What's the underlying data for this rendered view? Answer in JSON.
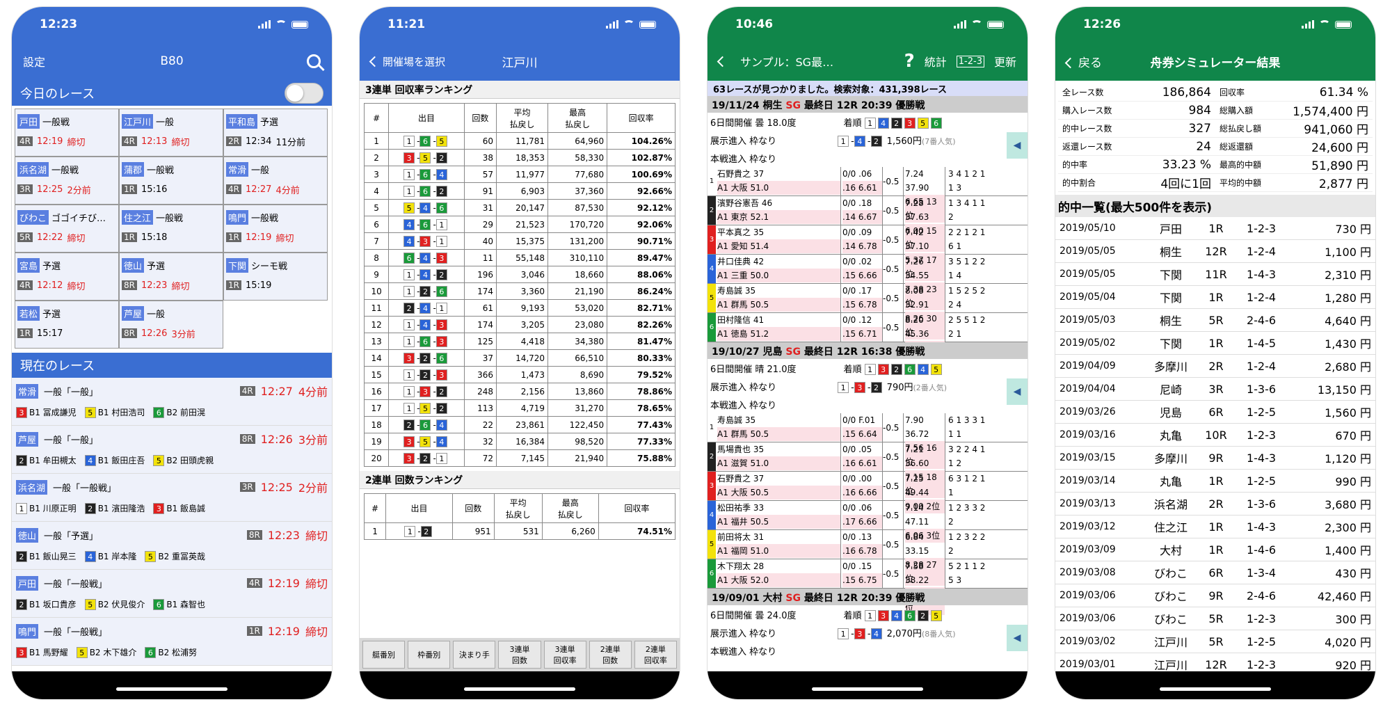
{
  "colors": {
    "blue": "#3a6ed2",
    "green": "#10864a",
    "red": "#e02020"
  },
  "p1": {
    "time": "12:23",
    "nav_left": "設定",
    "nav_title": "B80",
    "today_title": "今日のレース",
    "today": [
      {
        "venue": "戸田",
        "grade": "一般戦",
        "race": "4R",
        "time": "12:19",
        "status": "締切",
        "red": true
      },
      {
        "venue": "江戸川",
        "grade": "一般",
        "race": "4R",
        "time": "12:13",
        "status": "締切",
        "red": true
      },
      {
        "venue": "平和島",
        "grade": "予選",
        "race": "2R",
        "time": "12:34",
        "status": "11分前",
        "red": false
      },
      {
        "venue": "浜名湖",
        "grade": "一般戦",
        "race": "3R",
        "time": "12:25",
        "status": "2分前",
        "red": true
      },
      {
        "venue": "蒲郡",
        "grade": "一般戦",
        "race": "1R",
        "time": "15:16",
        "status": "",
        "red": false
      },
      {
        "venue": "常滑",
        "grade": "一般",
        "race": "4R",
        "time": "12:27",
        "status": "4分前",
        "red": true
      },
      {
        "venue": "びわこ",
        "grade": "ゴゴイチび…",
        "race": "5R",
        "time": "12:22",
        "status": "締切",
        "red": true
      },
      {
        "venue": "住之江",
        "grade": "一般戦",
        "race": "1R",
        "time": "15:18",
        "status": "",
        "red": false
      },
      {
        "venue": "鳴門",
        "grade": "一般戦",
        "race": "1R",
        "time": "12:19",
        "status": "締切",
        "red": true
      },
      {
        "venue": "宮島",
        "grade": "予選",
        "race": "4R",
        "time": "12:12",
        "status": "締切",
        "red": true
      },
      {
        "venue": "徳山",
        "grade": "予選",
        "race": "8R",
        "time": "12:23",
        "status": "締切",
        "red": true
      },
      {
        "venue": "下関",
        "grade": "シーモ戦",
        "race": "1R",
        "time": "15:19",
        "status": "",
        "red": false
      },
      {
        "venue": "若松",
        "grade": "予選",
        "race": "1R",
        "time": "15:17",
        "status": "",
        "red": false
      },
      {
        "venue": "芦屋",
        "grade": "一般",
        "race": "8R",
        "time": "12:26",
        "status": "3分前",
        "red": true
      }
    ],
    "current_title": "現在のレース",
    "current": [
      {
        "venue": "常滑",
        "name": "一般「一般」",
        "race": "4R",
        "time": "12:27",
        "status": "4分前",
        "boats": [
          [
            "3",
            "B1 冨成謙児"
          ],
          [
            "5",
            "B1 村田浩司"
          ],
          [
            "6",
            "B2 前田滉"
          ]
        ]
      },
      {
        "venue": "芦屋",
        "name": "一般「一般」",
        "race": "8R",
        "time": "12:26",
        "status": "3分前",
        "boats": [
          [
            "2",
            "B1 牟田槻太"
          ],
          [
            "4",
            "B1 飯田庄吾"
          ],
          [
            "5",
            "B2 田頭虎親"
          ]
        ]
      },
      {
        "venue": "浜名湖",
        "name": "一般「一般戦」",
        "race": "3R",
        "time": "12:25",
        "status": "2分前",
        "boats": [
          [
            "1",
            "B1 川原正明"
          ],
          [
            "2",
            "B1 濱田隆浩"
          ],
          [
            "3",
            "B1 飯島誠"
          ]
        ]
      },
      {
        "venue": "徳山",
        "name": "一般「予選」",
        "race": "8R",
        "time": "12:23",
        "status": "締切",
        "boats": [
          [
            "2",
            "B1 飯山晃三"
          ],
          [
            "4",
            "B1 岸本隆"
          ],
          [
            "5",
            "B2 重冨英哉"
          ]
        ]
      },
      {
        "venue": "戸田",
        "name": "一般「一般戦」",
        "race": "4R",
        "time": "12:19",
        "status": "締切",
        "boats": [
          [
            "2",
            "B1 坂口貴彦"
          ],
          [
            "5",
            "B2 伏見俊介"
          ],
          [
            "6",
            "B1 森智也"
          ]
        ]
      },
      {
        "venue": "鳴門",
        "name": "一般「一般戦」",
        "race": "1R",
        "time": "12:19",
        "status": "締切",
        "boats": [
          [
            "3",
            "B1 馬野耀"
          ],
          [
            "5",
            "B2 木下雄介"
          ],
          [
            "6",
            "B2 松浦努"
          ]
        ]
      }
    ]
  },
  "p2": {
    "time": "11:21",
    "nav_back": "開催場を選択",
    "nav_title": "江戸川",
    "t1_title": "3連単 回収率ランキング",
    "t1_headers": [
      "#",
      "出目",
      "回数",
      "平均\n払戻し",
      "最高\n払戻し",
      "回収率"
    ],
    "t1_rows": [
      [
        "1",
        "1-6-5",
        "60",
        "11,781",
        "64,960",
        "104.26%"
      ],
      [
        "2",
        "3-5-2",
        "38",
        "18,353",
        "58,330",
        "102.87%"
      ],
      [
        "3",
        "1-6-4",
        "57",
        "11,977",
        "77,680",
        "100.69%"
      ],
      [
        "4",
        "1-6-2",
        "91",
        "6,903",
        "37,360",
        "92.66%"
      ],
      [
        "5",
        "5-4-6",
        "31",
        "20,147",
        "87,530",
        "92.12%"
      ],
      [
        "6",
        "4-6-1",
        "29",
        "21,523",
        "170,720",
        "92.06%"
      ],
      [
        "7",
        "4-3-1",
        "40",
        "15,375",
        "131,200",
        "90.71%"
      ],
      [
        "8",
        "6-4-3",
        "11",
        "55,148",
        "310,110",
        "89.47%"
      ],
      [
        "9",
        "1-4-2",
        "196",
        "3,046",
        "18,660",
        "88.06%"
      ],
      [
        "10",
        "1-2-6",
        "174",
        "3,360",
        "21,190",
        "86.24%"
      ],
      [
        "11",
        "2-4-1",
        "61",
        "9,193",
        "53,020",
        "82.71%"
      ],
      [
        "12",
        "1-4-3",
        "174",
        "3,205",
        "23,080",
        "82.26%"
      ],
      [
        "13",
        "1-6-3",
        "125",
        "4,418",
        "34,380",
        "81.47%"
      ],
      [
        "14",
        "3-2-6",
        "37",
        "14,720",
        "66,510",
        "80.33%"
      ],
      [
        "15",
        "1-2-3",
        "366",
        "1,473",
        "8,690",
        "79.52%"
      ],
      [
        "16",
        "1-3-2",
        "248",
        "2,156",
        "13,860",
        "78.86%"
      ],
      [
        "17",
        "1-5-2",
        "113",
        "4,719",
        "31,270",
        "78.65%"
      ],
      [
        "18",
        "2-6-4",
        "22",
        "23,861",
        "122,450",
        "77.43%"
      ],
      [
        "19",
        "3-5-4",
        "32",
        "16,384",
        "98,520",
        "77.33%"
      ],
      [
        "20",
        "3-2-1",
        "72",
        "7,145",
        "21,940",
        "75.88%"
      ]
    ],
    "t2_title": "2連単 回数ランキング",
    "t2_rows": [
      [
        "1",
        "1-2",
        "951",
        "531",
        "6,260",
        "74.51%"
      ]
    ],
    "tabs": [
      "艇番別",
      "枠番別",
      "決まり手",
      "3連単\n回数",
      "3連単\n回収率",
      "2連単\n回数",
      "2連単\n回収率"
    ]
  },
  "p3": {
    "time": "10:46",
    "nav_title": "サンプル：SG最…",
    "nav_q": "?",
    "nav_stats": "統計",
    "nav_123": "1-2-3",
    "nav_update": "更新",
    "info": "63レースが見つかりました。検索対象：431,398レース",
    "races": [
      {
        "head_pre": "19/11/24 桐生 ",
        "sg": "SG",
        "head_post": " 最終日 12R 20:39 優勝戦",
        "cond": "6日間開催 曇 18.0度",
        "order_label": "着順",
        "order": [
          "1",
          "4",
          "2",
          "3",
          "5",
          "6"
        ],
        "entry": "展示進入 枠なり",
        "result": [
          "1",
          "4",
          "2"
        ],
        "payout": "1,560円",
        "pop": "(7番人気)",
        "main": "本戦進入 枠なり",
        "racers": [
          {
            "lane": "1",
            "n1": "石野貴之 37",
            "n2": "A1 大阪 51.0",
            "s1": "0/0 .06",
            "s2": ".16 6.61",
            "ex": "-0.5",
            "t1": "7.24 37.90",
            "t2": "6.65 13位",
            "r1": "3 4 1 2 1",
            "r2": "1 3"
          },
          {
            "lane": "2",
            "n1": "濱野谷憲吾 46",
            "n2": "A1 東京 52.1",
            "s1": "0/0 .18",
            "s2": ".14 6.67",
            "ex": "-0.5",
            "t1": "7.28 37.63",
            "t2": "6.00 15位",
            "r1": "1 3 4 1 1",
            "r2": "2"
          },
          {
            "lane": "3",
            "n1": "平本真之 35",
            "n2": "A1 愛知 51.4",
            "s1": "0/0 .09",
            "s2": ".14 6.78",
            "ex": "-0.5",
            "t1": "7.42 37.10",
            "t2": "5.37 17位",
            "r1": "2 2 1 2 1",
            "r2": "6 1"
          },
          {
            "lane": "4",
            "n1": "井口佳典 42",
            "n2": "A1 三重 50.0",
            "s1": "0/0 .02",
            "s2": ".15 6.66",
            "ex": "-0.5",
            "t1": "7.26 34.55",
            "t2": "7.38 23位",
            "r1": "3 5 1 2 2",
            "r2": "1 4"
          },
          {
            "lane": "5",
            "n1": "寿島誠 35",
            "n2": "A1 群馬 50.5",
            "s1": "0/0 .17",
            "s2": ".15 6.78",
            "ex": "-0.5",
            "t1": "8.08 32.91",
            "t2": "8.26 30位",
            "r1": "1 5 2 5 2",
            "r2": "2 4"
          },
          {
            "lane": "6",
            "n1": "田村隆信 41",
            "n2": "A1 徳島 51.2",
            "s1": "0/0 .12",
            "s2": ".15 6.71",
            "ex": "-0.5",
            "t1": "8.20 45.36",
            "t2": "6.33 5位",
            "r1": "2 5 5 1 2",
            "r2": "2 1"
          }
        ]
      },
      {
        "head_pre": "19/10/27 児島 ",
        "sg": "SG",
        "head_post": " 最終日 12R 16:38 優勝戦",
        "cond": "6日間開催 晴 21.0度",
        "order_label": "着順",
        "order": [
          "1",
          "3",
          "2",
          "6",
          "4",
          "5"
        ],
        "entry": "展示進入 枠なり",
        "result": [
          "1",
          "3",
          "2"
        ],
        "payout": "790円",
        "pop": "(2番人気)",
        "main": "本戦進入 枠なり",
        "racers": [
          {
            "lane": "1",
            "n1": "寿島誠 35",
            "n2": "A1 群馬 50.5",
            "s1": "0/0 F.01",
            "s2": ".15 6.64",
            "ex": "-0.5",
            "t1": "7.90 36.72",
            "t2": "7.56 16位",
            "r1": "6 1 3 3 1",
            "r2": "1 1"
          },
          {
            "lane": "2",
            "n1": "馬場貴也 35",
            "n2": "A1 滋賀 51.0",
            "s1": "0/0 .05",
            "s2": ".16 6.61",
            "ex": "-0.5",
            "t1": "7.21 36.60",
            "t2": "7.15 18位",
            "r1": "3 2 2 4 1",
            "r2": "1 2"
          },
          {
            "lane": "3",
            "n1": "石野貴之 37",
            "n2": "A1 大阪 50.5",
            "s1": "0/0 .00",
            "s2": ".16 6.66",
            "ex": "-0.5",
            "t1": "7.25 49.44",
            "t2": "9.00 2位",
            "r1": "6 3 1 2 1",
            "r2": "1"
          },
          {
            "lane": "4",
            "n1": "松田祐季 33",
            "n2": "A1 福井 50.5",
            "s1": "0/0 .06",
            "s2": ".17 6.66",
            "ex": "-0.5",
            "t1": "7.14 47.11",
            "t2": "6.06 3位",
            "r1": "1 2 3 3 2",
            "r2": "2"
          },
          {
            "lane": "5",
            "n1": "前田将太 31",
            "n2": "A1 福岡 51.0",
            "s1": "0/0 .13",
            "s2": ".16 6.78",
            "ex": "-0.5",
            "t1": "6.84 33.15",
            "t2": "8.28 27位",
            "r1": "1 2 3 2 2",
            "r2": "2"
          },
          {
            "lane": "6",
            "n1": "木下翔太 28",
            "n2": "A1 大阪 52.0",
            "s1": "0/0 .15",
            "s2": ".15 6.75",
            "ex": "-0.5",
            "t1": "7.58 38.22",
            "t2": "6.11 14位",
            "r1": "5 2 1 1 2",
            "r2": "5 3"
          }
        ]
      },
      {
        "head_pre": "19/09/01 大村 ",
        "sg": "SG",
        "head_post": " 最終日 12R 20:39 優勝戦",
        "cond": "6日間開催 曇 24.0度",
        "order_label": "着順",
        "order": [
          "1",
          "3",
          "4",
          "6",
          "2",
          "5"
        ],
        "entry": "展示進入 枠なり",
        "result": [
          "1",
          "3",
          "4"
        ],
        "payout": "2,070円",
        "pop": "(8番人気)",
        "main": "本戦進入 枠なり",
        "racers": []
      }
    ]
  },
  "p4": {
    "time": "12:26",
    "nav_back": "戻る",
    "nav_title": "舟券シミュレーター結果",
    "stats": [
      [
        "全レース数",
        "186,864"
      ],
      [
        "回収率",
        "61.34 %"
      ],
      [
        "購入レース数",
        "984"
      ],
      [
        "総購入額",
        "1,574,400 円"
      ],
      [
        "的中レース数",
        "327"
      ],
      [
        "総払戻し額",
        "941,060 円"
      ],
      [
        "返還レース数",
        "24"
      ],
      [
        "総返還額",
        "24,600 円"
      ],
      [
        "的中率",
        "33.23 %"
      ],
      [
        "最高的中額",
        "51,890 円"
      ],
      [
        "的中割合",
        "4回に1回"
      ],
      [
        "平均的中額",
        "2,877 円"
      ]
    ],
    "hits_title": "的中一覧(最大500件を表示)",
    "hits": [
      [
        "2019/05/10",
        "戸田",
        "1R",
        "1-2-3",
        "730 円"
      ],
      [
        "2019/05/05",
        "桐生",
        "12R",
        "1-2-4",
        "1,100 円"
      ],
      [
        "2019/05/05",
        "下関",
        "11R",
        "1-4-3",
        "2,310 円"
      ],
      [
        "2019/05/04",
        "下関",
        "1R",
        "1-2-4",
        "1,280 円"
      ],
      [
        "2019/05/03",
        "桐生",
        "5R",
        "2-4-6",
        "4,640 円"
      ],
      [
        "2019/05/02",
        "下関",
        "1R",
        "1-4-5",
        "1,430 円"
      ],
      [
        "2019/04/09",
        "多摩川",
        "2R",
        "1-2-4",
        "2,680 円"
      ],
      [
        "2019/04/04",
        "尼崎",
        "3R",
        "1-3-6",
        "13,150 円"
      ],
      [
        "2019/03/26",
        "児島",
        "6R",
        "1-2-5",
        "1,560 円"
      ],
      [
        "2019/03/16",
        "丸亀",
        "10R",
        "1-2-3",
        "670 円"
      ],
      [
        "2019/03/15",
        "多摩川",
        "9R",
        "1-4-3",
        "1,120 円"
      ],
      [
        "2019/03/14",
        "丸亀",
        "1R",
        "1-2-5",
        "990 円"
      ],
      [
        "2019/03/13",
        "浜名湖",
        "2R",
        "1-3-6",
        "3,680 円"
      ],
      [
        "2019/03/12",
        "住之江",
        "1R",
        "1-4-3",
        "2,300 円"
      ],
      [
        "2019/03/09",
        "大村",
        "1R",
        "1-4-6",
        "1,400 円"
      ],
      [
        "2019/03/08",
        "びわこ",
        "6R",
        "1-3-4",
        "430 円"
      ],
      [
        "2019/03/06",
        "びわこ",
        "9R",
        "2-4-6",
        "42,460 円"
      ],
      [
        "2019/03/06",
        "びわこ",
        "5R",
        "1-2-3",
        "300 円"
      ],
      [
        "2019/03/02",
        "江戸川",
        "5R",
        "1-2-5",
        "4,020 円"
      ],
      [
        "2019/03/01",
        "江戸川",
        "12R",
        "1-2-3",
        "920 円"
      ]
    ]
  }
}
